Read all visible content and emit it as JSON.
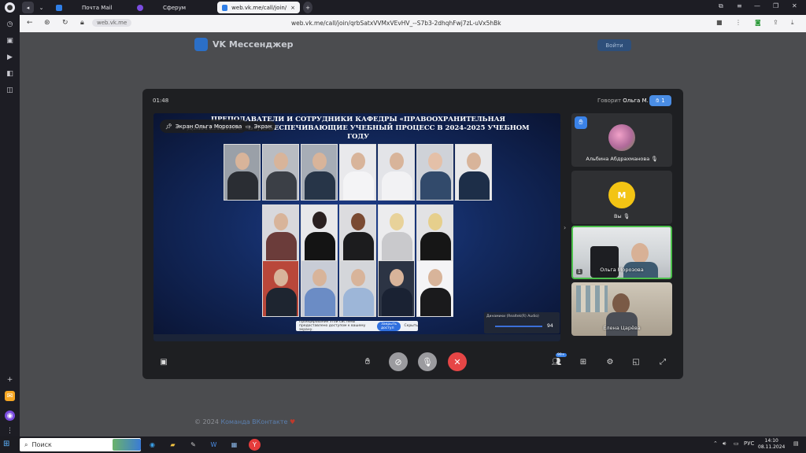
{
  "browser": {
    "tabs": [
      {
        "label": "Почта Mail",
        "color": "#2f7fe8"
      },
      {
        "label": "Сферум",
        "color": "#7b4de0"
      },
      {
        "label": "web.vk.me/call/join/",
        "color": "#2f7fe8"
      }
    ],
    "domain": "web.vk.me",
    "url": "web.vk.me/call/join/qrbSatxVVMxVEvHV_--S7b3-2dhqhFwj7zL-uVx5hBk"
  },
  "page": {
    "brand": "VK Мессенджер",
    "login_label": "Войти",
    "footer_copyright": "© 2024",
    "footer_team": "Команда ВКонтакте"
  },
  "call": {
    "timer": "01:48",
    "speaking_prefix": "Говорит",
    "speaking_name": "Ольга М.",
    "raised_hands": "1",
    "screen_share_label": "Экран Ольга Морозова",
    "screen_chip_2": "Экран",
    "slide_title": "ПРЕПОДАВАТЕЛИ И СОТРУДНИКИ КАФЕДРЫ «ПРАВООХРАНИТЕЛЬНАЯ ДЕЯТЕЛЬНОСТЬ», ОБЕСПЕЧИВАЮЩИЕ УЧЕБНЫЙ ПРОЦЕСС В 2024-2025 УЧЕБНОМ ГОДУ",
    "notice_text": "Проецирование этой системы предоставлено доступом к вашему экрану.",
    "notice_button": "Закрыть доступ",
    "notice_hide": "Скрыть",
    "volume_title": "Динамики (Realtek(R) Audio)",
    "volume_value": "94",
    "participants_badge": "99+",
    "participants": [
      {
        "name": "Альбина Абдрахманова",
        "avatar_color": "#c98ab5"
      },
      {
        "name": "Вы",
        "initial": "М",
        "avatar_color": "#f3c414"
      },
      {
        "name": "Ольга Морозова",
        "index": "1"
      },
      {
        "name": "Елена Царёва"
      }
    ]
  },
  "taskbar": {
    "search_placeholder": "Поиск",
    "lang": "РУС",
    "time": "14:10",
    "date": "08.11.2024"
  }
}
